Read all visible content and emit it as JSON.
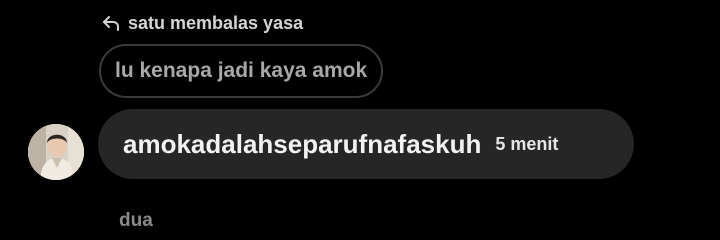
{
  "reply": {
    "icon": "reply-arrow-icon",
    "context_text": "satu membalas yasa",
    "quoted_message": "lu kenapa jadi kaya amok"
  },
  "message": {
    "avatar_icon": "user-avatar",
    "text": "amokadalahseparufnafaskuh",
    "timestamp": "5 menit"
  },
  "footer": {
    "label": "dua"
  },
  "colors": {
    "background": "#000000",
    "bubble": "#262626",
    "quoted_border": "#3a3a3a",
    "muted_text": "#a8a8a8"
  }
}
